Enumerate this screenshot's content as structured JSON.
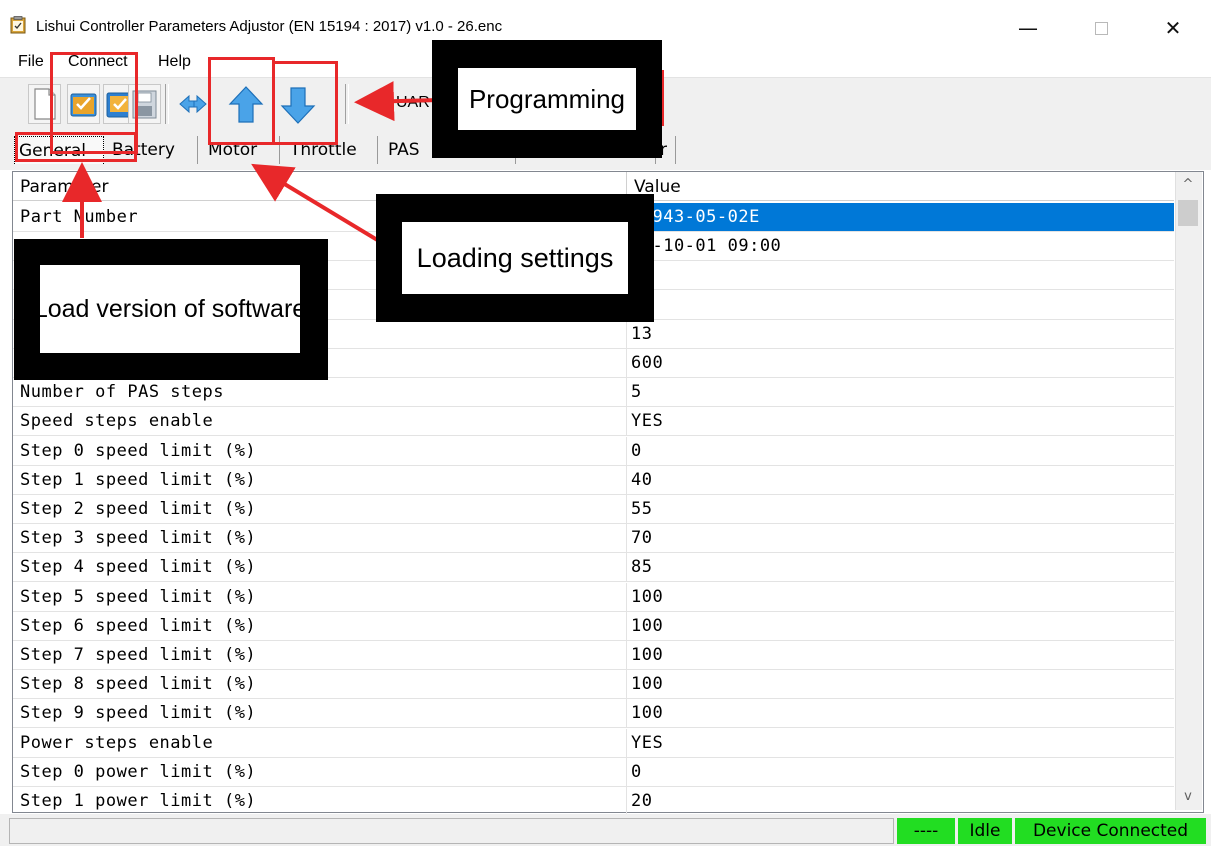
{
  "window": {
    "title": "Lishui Controller Parameters Adjustor (EN 15194 : 2017) v1.0 - 26.enc",
    "minimize_glyph": "—",
    "close_glyph": "✕"
  },
  "menu": [
    "File",
    "Connect",
    "Help"
  ],
  "toolbar": {
    "buttons": [
      {
        "icon": "new-file-icon"
      },
      {
        "icon": "open-folder-icon"
      },
      {
        "icon": "save-icon"
      },
      {
        "icon": "swap-arrows-icon"
      },
      {
        "icon": "upload-arrow-icon"
      },
      {
        "icon": "download-arrow-icon"
      }
    ],
    "port_label": "UAR"
  },
  "tabs": [
    "General",
    "Battery",
    "Motor",
    "Throttle",
    "PAS",
    "",
    "r"
  ],
  "table": {
    "headers": {
      "parameter": "Parameter",
      "value": "Value"
    },
    "rows": [
      {
        "parameter": "Part Number",
        "value": "W0943-05-02E",
        "selected": true
      },
      {
        "parameter": "",
        "value": "20-10-01 09:00"
      },
      {
        "parameter": "",
        "value": ""
      },
      {
        "parameter": "",
        "value": ""
      },
      {
        "parameter": "",
        "value": "13"
      },
      {
        "parameter": "",
        "value": "600"
      },
      {
        "parameter": "Number of PAS steps",
        "value": "5"
      },
      {
        "parameter": "Speed steps enable",
        "value": "YES"
      },
      {
        "parameter": "Step 0 speed limit (%)",
        "value": "0"
      },
      {
        "parameter": "Step 1 speed limit (%)",
        "value": "40"
      },
      {
        "parameter": "Step 2 speed limit (%)",
        "value": "55"
      },
      {
        "parameter": "Step 3 speed limit (%)",
        "value": "70"
      },
      {
        "parameter": "Step 4 speed limit (%)",
        "value": "85"
      },
      {
        "parameter": "Step 5 speed limit (%)",
        "value": "100"
      },
      {
        "parameter": "Step 6 speed limit (%)",
        "value": "100"
      },
      {
        "parameter": "Step 7 speed limit (%)",
        "value": "100"
      },
      {
        "parameter": "Step 8 speed limit (%)",
        "value": "100"
      },
      {
        "parameter": "Step 9 speed limit (%)",
        "value": "100"
      },
      {
        "parameter": "Power steps enable",
        "value": "YES"
      },
      {
        "parameter": "Step 0 power limit (%)",
        "value": "0"
      },
      {
        "parameter": "Step 1 power limit (%)",
        "value": "20"
      }
    ]
  },
  "scrollbar": {
    "up_glyph": "^",
    "down_glyph": "v"
  },
  "status": {
    "dashes": "----",
    "state": "Idle",
    "connection": "Device Connected",
    "color": "#22dd22"
  },
  "annotations": {
    "programming": "Programming",
    "loading_settings": "Loading settings",
    "load_version": "Load version of software",
    "accent_color": "#e8282a"
  }
}
